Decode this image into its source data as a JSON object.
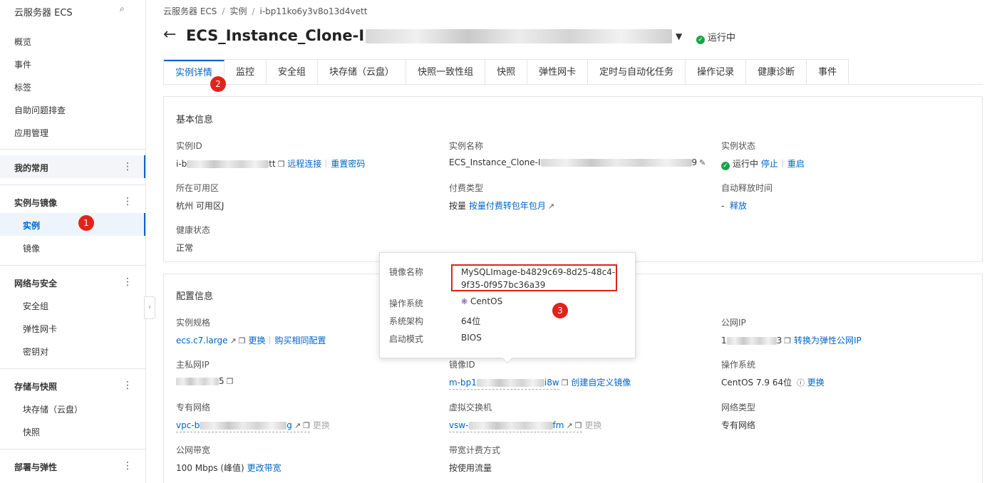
{
  "sidebar": {
    "title": "云服务器 ECS",
    "search_icon": "search-icon",
    "items": [
      {
        "label": "概览"
      },
      {
        "label": "事件"
      },
      {
        "label": "标签"
      },
      {
        "label": "自助问题排查"
      },
      {
        "label": "应用管理"
      }
    ],
    "favorites": "我的常用",
    "groups": [
      {
        "label": "实例与镜像",
        "children": [
          "实例",
          "镜像"
        ]
      },
      {
        "label": "网络与安全",
        "children": [
          "安全组",
          "弹性网卡",
          "密钥对"
        ]
      },
      {
        "label": "存储与快照",
        "children": [
          "块存储（云盘）",
          "快照"
        ]
      },
      {
        "label": "部署与弹性",
        "children": []
      }
    ],
    "collapse_glyph": "‹"
  },
  "breadcrumb": {
    "items": [
      "云服务器 ECS",
      "实例",
      "i-bp11ko6y3v8o13d4vett"
    ],
    "sep": "/"
  },
  "header": {
    "back_glyph": "←",
    "title_prefix": "ECS_Instance_Clone-I",
    "caret_glyph": "▼",
    "status": "运行中"
  },
  "badges": [
    "1",
    "2",
    "3"
  ],
  "tabs": [
    "实例详情",
    "监控",
    "安全组",
    "块存储（云盘）",
    "快照一致性组",
    "快照",
    "弹性网卡",
    "定时与自动化任务",
    "操作记录",
    "健康诊断",
    "事件"
  ],
  "basic": {
    "title": "基本信息",
    "instance_id_label": "实例ID",
    "instance_id_prefix": "i-b",
    "instance_id_suffix": "tt",
    "remote_connect": "远程连接",
    "reset_password": "重置密码",
    "instance_name_label": "实例名称",
    "instance_name_prefix": "ECS_Instance_Clone-I",
    "instance_name_suffix": "9",
    "status_label": "实例状态",
    "status_value": "运行中",
    "stop": "停止",
    "restart": "重启",
    "zone_label": "所在可用区",
    "zone_value": "杭州 可用区J",
    "billing_label": "付费类型",
    "billing_value": "按量",
    "billing_link": "按量付费转包年包月",
    "release_label": "自动释放时间",
    "release_value": "-",
    "release_link": "释放",
    "health_label": "健康状态",
    "health_value": "正常"
  },
  "config": {
    "title": "配置信息",
    "spec_label": "实例规格",
    "spec_value": "ecs.c7.large",
    "change": "更换",
    "buy_same": "购买相同配置",
    "public_ip_label": "公网IP",
    "public_ip_prefix": "1",
    "public_ip_suffix": "3",
    "to_eip": "转换为弹性公网IP",
    "private_ip_label": "主私网IP",
    "private_ip_suffix": "5",
    "image_id_label": "镜像ID",
    "image_id_prefix": "m-bp1",
    "image_id_suffix": "i8w",
    "create_image": "创建自定义镜像",
    "os_label": "操作系统",
    "os_value": "CentOS 7.9 64位",
    "os_change": "更换",
    "vpc_label": "专有网络",
    "vpc_prefix": "vpc-b",
    "vpc_suffix": "g",
    "vpc_change": "更换",
    "vswitch_label": "虚拟交换机",
    "vswitch_prefix": "vsw-",
    "vswitch_suffix": "fm",
    "vswitch_change": "更换",
    "net_type_label": "网络类型",
    "net_type_value": "专有网络",
    "bandwidth_label": "公网带宽",
    "bandwidth_value": "100 Mbps (峰值)",
    "change_bandwidth": "更改带宽",
    "bw_billing_label": "带宽计费方式",
    "bw_billing_value": "按使用流量"
  },
  "image_popup": {
    "image_name_label": "镜像名称",
    "image_name_line1": "MySQLImage-b4829c69-8d25-48c4-",
    "image_name_line2": "9f35-0f957bc36a39",
    "os_label": "操作系统",
    "os_value": "CentOS",
    "arch_label": "系统架构",
    "arch_value": "64位",
    "boot_label": "启动模式",
    "boot_value": "BIOS"
  },
  "colors": {
    "link": "#0064c8",
    "ok": "#1aa34a",
    "badge": "#e2231a"
  }
}
